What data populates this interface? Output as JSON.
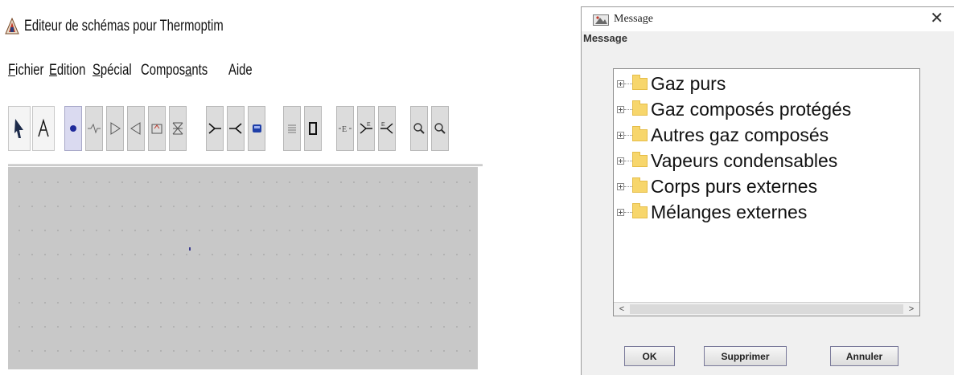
{
  "editor": {
    "title": "Editeur de schémas pour Thermoptim",
    "menu": [
      {
        "before": "",
        "mnemonic": "F",
        "after": "ichier"
      },
      {
        "before": "",
        "mnemonic": "E",
        "after": "dition"
      },
      {
        "before": "",
        "mnemonic": "S",
        "after": "pécial"
      },
      {
        "before": "Compos",
        "mnemonic": "a",
        "after": "nts"
      },
      {
        "before": "",
        "mnemonic": "",
        "after": "Aide"
      }
    ]
  },
  "dialog": {
    "title": "Message",
    "label": "Message",
    "close": "✕",
    "tree_items": [
      "Gaz purs",
      "Gaz composés protégés",
      "Autres gaz composés",
      "Vapeurs condensables",
      "Corps purs externes",
      "Mélanges externes"
    ],
    "buttons": {
      "ok": "OK",
      "delete": "Supprimer",
      "cancel": "Annuler"
    }
  }
}
